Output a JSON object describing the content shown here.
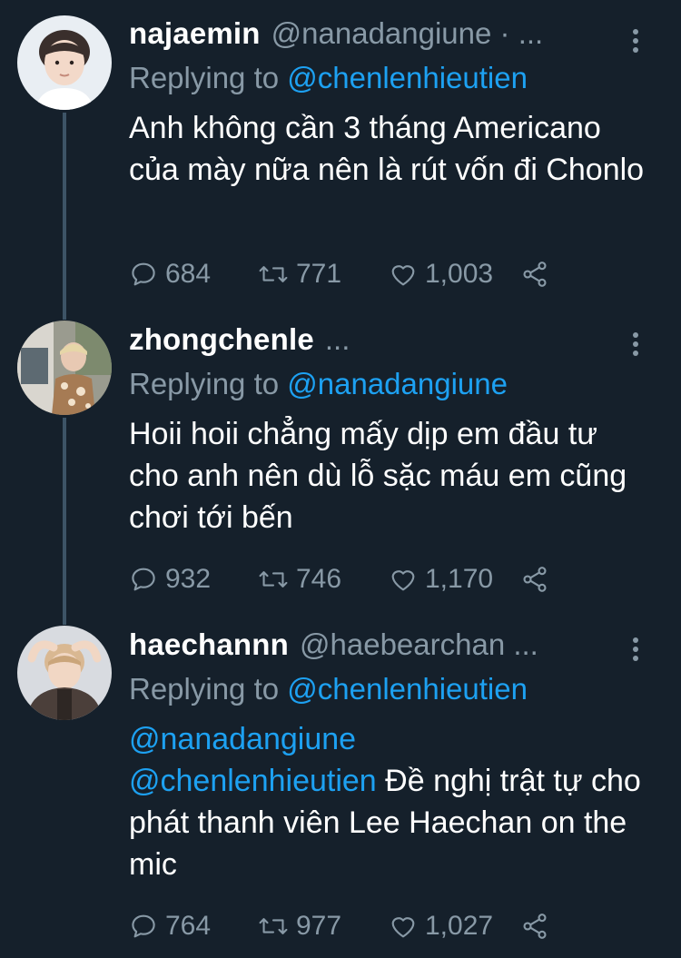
{
  "tweets": [
    {
      "name": "najaemin",
      "handle": "@nanadangiune · ...",
      "replying_prefix": "Replying to ",
      "replying_to": "@chenlenhieutien",
      "text": "Anh không cần 3 tháng Americano của mày nữa nên là rút vốn đi Chonlo",
      "replies": "684",
      "retweets": "771",
      "likes": "1,003"
    },
    {
      "name": "zhongchenle",
      "handle": "...",
      "replying_prefix": "Replying to ",
      "replying_to": "@nanadangiune",
      "text": "Hoii hoii chẳng mấy dịp em đầu tư cho anh nên dù lỗ sặc máu em cũng chơi tới bến",
      "replies": "932",
      "retweets": "746",
      "likes": "1,170"
    },
    {
      "name": "haechannn",
      "handle": "@haebearchan ...",
      "replying_prefix": "Replying to ",
      "replying_to": "@chenlenhieutien",
      "mention_1": "@nanadangiune",
      "mention_2": "@chenlenhieutien",
      "text": " Đề nghị trật tự cho phát thanh viên Lee Haechan on the mic",
      "replies": "764",
      "retweets": "977",
      "likes": "1,027"
    }
  ],
  "icons": {
    "reply": "reply-icon",
    "retweet": "retweet-icon",
    "like": "heart-icon",
    "share": "share-icon",
    "more": "more-vertical-icon"
  },
  "colors": {
    "background": "#15202b",
    "secondary_text": "#8899a6",
    "link": "#1da1f2"
  }
}
